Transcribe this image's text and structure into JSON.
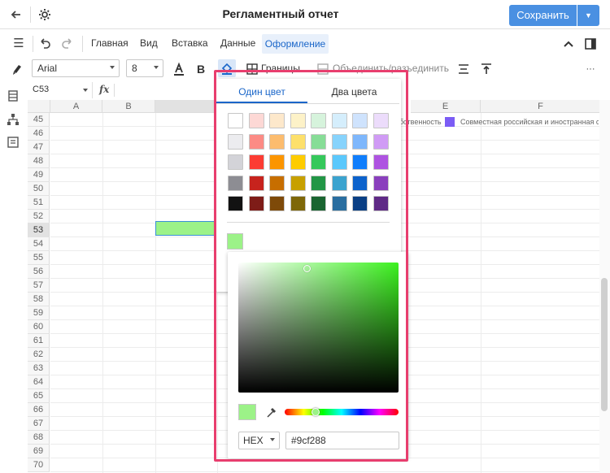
{
  "titlebar": {
    "title": "Регламентный отчет",
    "save_label": "Сохранить"
  },
  "menu": {
    "items": [
      "Главная",
      "Вид",
      "Вставка",
      "Данные"
    ],
    "active": "Оформление"
  },
  "toolbar": {
    "font": "Arial",
    "size": "8",
    "borders_label": "Границы",
    "merge_label": "Объединить/разъединить",
    "more": "···"
  },
  "formula_bar": {
    "cell_ref": "C53",
    "fx_label": "fx"
  },
  "grid": {
    "columns": [
      "A",
      "B",
      "E",
      "F"
    ],
    "rows": [
      "45",
      "46",
      "47",
      "48",
      "49",
      "50",
      "51",
      "52",
      "53",
      "54",
      "55",
      "56",
      "57",
      "58",
      "59",
      "60",
      "61",
      "62",
      "63",
      "64",
      "65",
      "66",
      "67",
      "68",
      "69",
      "70"
    ],
    "selected_row": "53",
    "selected_fill": "#9cf288",
    "legend_prev": "обственность",
    "legend_label": "Совместная российская и иностранная соб",
    "legend_color": "#7b5cf5"
  },
  "popup": {
    "tabs": [
      "Один цвет",
      "Два цвета"
    ],
    "active_tab": "Один цвет",
    "palette": [
      [
        "#ffffff",
        "#fdd8d5",
        "#fde8cb",
        "#fdf2c8",
        "#d6f3dc",
        "#d5eefc",
        "#cfe3fd",
        "#ecdcfb"
      ],
      [
        "#ececef",
        "#fc8b85",
        "#fcbc6e",
        "#fde06b",
        "#87dd97",
        "#87d3fc",
        "#7eb7fc",
        "#d09bf5"
      ],
      [
        "#d3d3d8",
        "#fc3c33",
        "#fc9500",
        "#fecc00",
        "#35c85b",
        "#5bc8fc",
        "#107efc",
        "#ae53e1"
      ],
      [
        "#8d8d93",
        "#c7231d",
        "#c76e00",
        "#c7a000",
        "#229646",
        "#3ba3cf",
        "#0c62cc",
        "#8a3fbd"
      ],
      [
        "#121212",
        "#7e1c18",
        "#7e4a09",
        "#7e6708",
        "#1a6531",
        "#2a6ea0",
        "#0a3f85",
        "#5f2a86"
      ]
    ],
    "current_color": "#9cf288",
    "base_hue": "#3cf21f",
    "hue_position": 0.27,
    "saturation": 0.43,
    "brightness": 0.95,
    "format": "HEX",
    "hex_value": "#9cf288"
  }
}
